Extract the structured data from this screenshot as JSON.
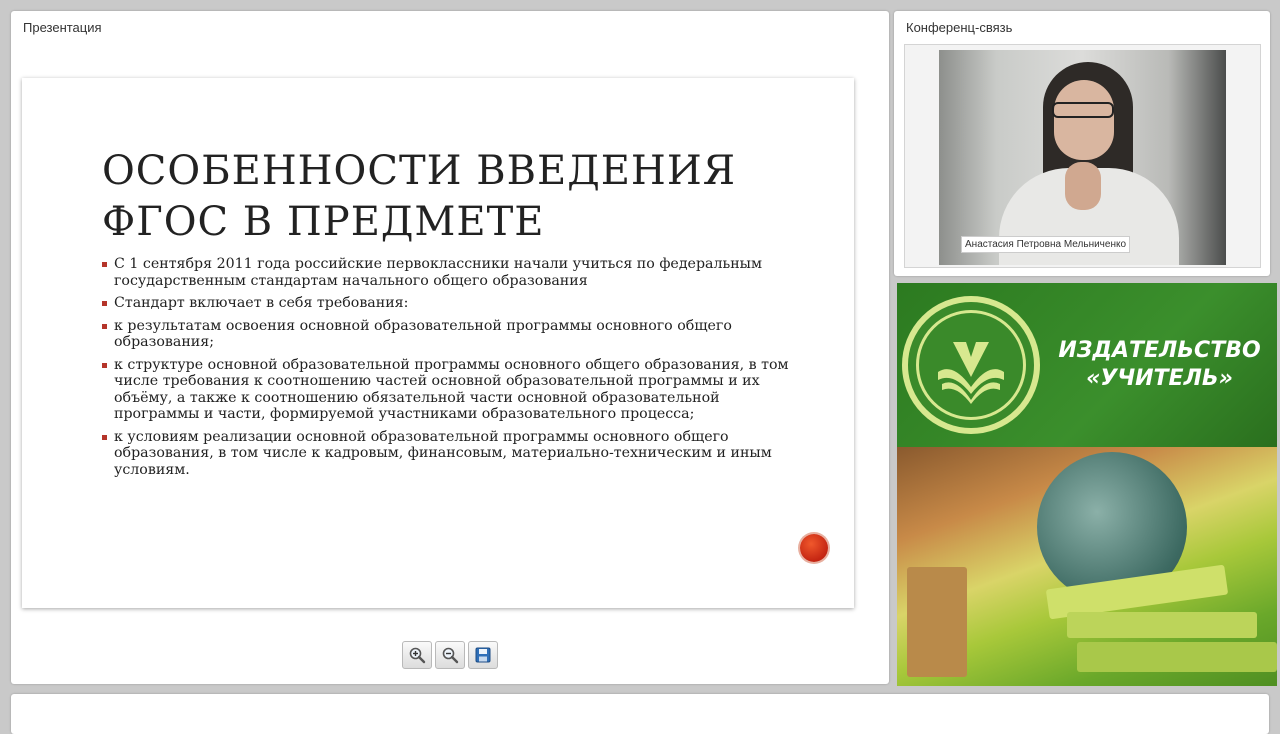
{
  "presentation": {
    "panel_title": "Презентация",
    "slide": {
      "title_line1": "ОСОБЕННОСТИ ВВЕДЕНИЯ",
      "title_line2": "ФГОС В ПРЕДМЕТЕ",
      "bullets": [
        "С 1 сентября 2011 года российские первоклассники начали учиться по федеральным государственным стандартам начального общего образования",
        "Стандарт включает в себя требования:",
        "к результатам освоения основной образовательной программы основного общего образования;",
        "к структуре основной образовательной программы основного общего образования, в том числе требования к соотношению частей основной образовательной программы и их объёму, а также к соотношению обязательной части основной образовательной программы и части, формируемой участниками образовательного процесса;",
        "к условиям реализации основной образовательной программы основного общего образования, в том числе к кадровым, финансовым, материально-техническим и иным условиям."
      ]
    },
    "toolbar": {
      "zoom_in_icon": "zoom-in-icon",
      "zoom_out_icon": "zoom-out-icon",
      "save_icon": "save-icon"
    }
  },
  "conference": {
    "panel_title": "Конференц-связь",
    "caller_name": "Анастасия Петровна Мельниченко"
  },
  "publisher": {
    "name_line1": "ИЗДАТЕЛЬСТВО",
    "name_line2": "«УЧИТЕЛЬ»"
  },
  "colors": {
    "banner_green": "#2f7d23",
    "bullet_red": "#b5352a",
    "record_red": "#d6321a"
  }
}
